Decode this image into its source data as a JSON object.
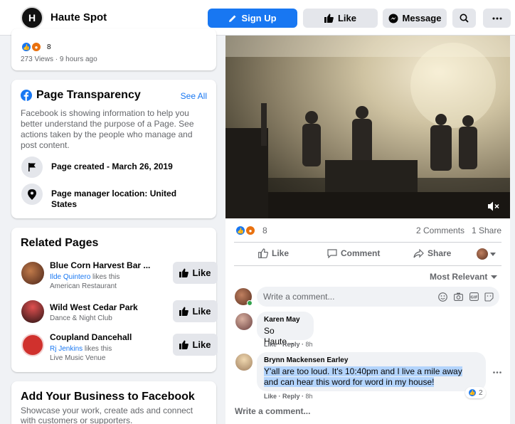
{
  "header": {
    "logo_text": "H",
    "page_name": "Haute Spot",
    "signup_label": "Sign Up",
    "like_label": "Like",
    "message_label": "Message"
  },
  "top_card": {
    "reaction_count": "8",
    "views_line": "273 Views · 9 hours ago"
  },
  "transparency": {
    "title": "Page Transparency",
    "see_all": "See All",
    "description": "Facebook is showing information to help you better understand the purpose of a Page. See actions taken by the people who manage and post content.",
    "created": "Page created - March 26, 2019",
    "location": "Page manager location: United States"
  },
  "related": {
    "title": "Related Pages",
    "like_label": "Like",
    "items": [
      {
        "name": "Blue Corn Harvest Bar ...",
        "link": "Ilde Quintero",
        "likes_this": " likes this",
        "category": "American Restaurant",
        "color": "#6b3a2a"
      },
      {
        "name": "Wild West Cedar Park",
        "link": "",
        "likes_this": "",
        "category": "Dance & Night Club",
        "color": "#3a2a2a"
      },
      {
        "name": "Coupland Dancehall",
        "link": "Rj Jenkins",
        "likes_this": " likes this",
        "category": "Live Music Venue",
        "color": "#d0312d"
      }
    ]
  },
  "add_business": {
    "title": "Add Your Business to Facebook",
    "text": "Showcase your work, create ads and connect with customers or supporters."
  },
  "post": {
    "reaction_count": "8",
    "comments_count": "2 Comments",
    "shares_count": "1 Share",
    "action_like": "Like",
    "action_comment": "Comment",
    "action_share": "Share",
    "sort_label": "Most Relevant",
    "write_placeholder": "Write a comment...",
    "write_placeholder_bottom": "Write a comment...",
    "comments": [
      {
        "author": "Karen May",
        "text": "So Haute...",
        "like": "Like",
        "reply": "Reply",
        "time": "8h"
      },
      {
        "author": "Brynn Mackensen Earley",
        "text": "Y'all are too loud. It's 10:40pm and I live a mile away and can hear this word for word in my house!",
        "like": "Like",
        "reply": "Reply",
        "time": "8h",
        "reactions": "2"
      }
    ]
  },
  "colors": {
    "brand_blue": "#1877f2",
    "grey_button": "#e4e6eb",
    "page_bg": "#f0f2f5"
  }
}
